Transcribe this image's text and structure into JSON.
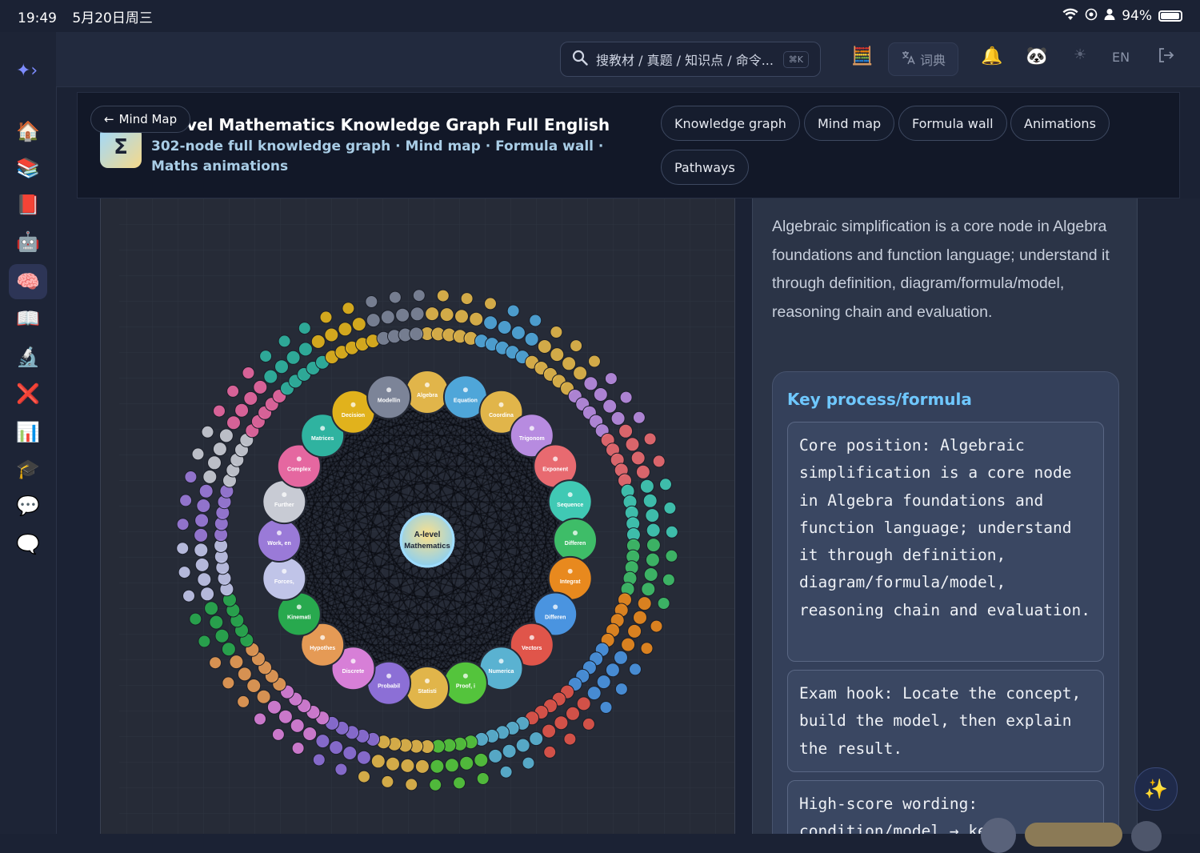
{
  "status": {
    "time": "19:49",
    "date": "5月20日周三",
    "battery": "94%",
    "battery_level": 0.94
  },
  "search": {
    "placeholder": "搜教材 / 真题 / 知识点 / 命令...",
    "shortcut": "⌘K"
  },
  "toolbar": {
    "dict_label": "词典",
    "lang_label": "EN"
  },
  "header": {
    "back_label": "Mind Map",
    "title": "vel Mathematics Knowledge Graph Full English",
    "logo_symbol": "Σ",
    "subtitle": "302-node full knowledge graph · Mind map · Formula wall · Maths animations"
  },
  "tabs": [
    {
      "label": "Knowledge graph"
    },
    {
      "label": "Mind map"
    },
    {
      "label": "Formula wall"
    },
    {
      "label": "Animations"
    },
    {
      "label": "Pathways"
    }
  ],
  "graph": {
    "center_line1": "A-level",
    "center_line2": "Mathematics",
    "branches": [
      {
        "label": "Algebra",
        "color": "#e1b54a"
      },
      {
        "label": "Equation",
        "color": "#4fa6d9"
      },
      {
        "label": "Coordina",
        "color": "#e1b54a"
      },
      {
        "label": "Trigonom",
        "color": "#b78be0"
      },
      {
        "label": "Exponent",
        "color": "#e86a70"
      },
      {
        "label": "Sequence",
        "color": "#40c9b4"
      },
      {
        "label": "Differen",
        "color": "#3ebd68"
      },
      {
        "label": "Integrat",
        "color": "#e8891e"
      },
      {
        "label": "Differen",
        "color": "#4a94e0"
      },
      {
        "label": "Vectors",
        "color": "#e0554a"
      },
      {
        "label": "Numerica",
        "color": "#5ab2d1"
      },
      {
        "label": "Proof, i",
        "color": "#54c43c"
      },
      {
        "label": "Statisti",
        "color": "#e1b54a"
      },
      {
        "label": "Probabil",
        "color": "#8c6fd6"
      },
      {
        "label": "Discrete",
        "color": "#d77fd7"
      },
      {
        "label": "Hypothes",
        "color": "#e59a55"
      },
      {
        "label": "Kinemati",
        "color": "#28a94e"
      },
      {
        "label": "Forces,",
        "color": "#c0c4e8"
      },
      {
        "label": "Work, en",
        "color": "#9a7ad8"
      },
      {
        "label": "Further",
        "color": "#c8cbd4"
      },
      {
        "label": "Complex",
        "color": "#e567a0"
      },
      {
        "label": "Matrices",
        "color": "#2fb3a0"
      },
      {
        "label": "Decision",
        "color": "#e1b21c"
      },
      {
        "label": "Modellin",
        "color": "#7c8498"
      }
    ],
    "leaf_colors": [
      "#e1b54a",
      "#4fa6d9",
      "#b78be0",
      "#e86a70",
      "#40c9b4",
      "#3ebd68",
      "#e8891e",
      "#e0554a",
      "#8c6fd6",
      "#d77fd7",
      "#28a94e",
      "#c0c4e8",
      "#e567a0",
      "#2fb3a0",
      "#7c8498"
    ],
    "leaf_count": 278
  },
  "detail": {
    "intro": "Algebraic simplification is a core node in Algebra foundations and function language; understand it through definition, diagram/formula/model, reasoning chain and evaluation.",
    "kp_title": "Key process/formula",
    "box1": "Core position: Algebraic simplification is a core node in Algebra foundations and function language; understand it through definition, diagram/formula/model, reasoning chain and evaluation.",
    "box2": "Exam hook: Locate the concept, build the model, then explain the result.",
    "box3": "High-score wording: condition/model → key"
  }
}
